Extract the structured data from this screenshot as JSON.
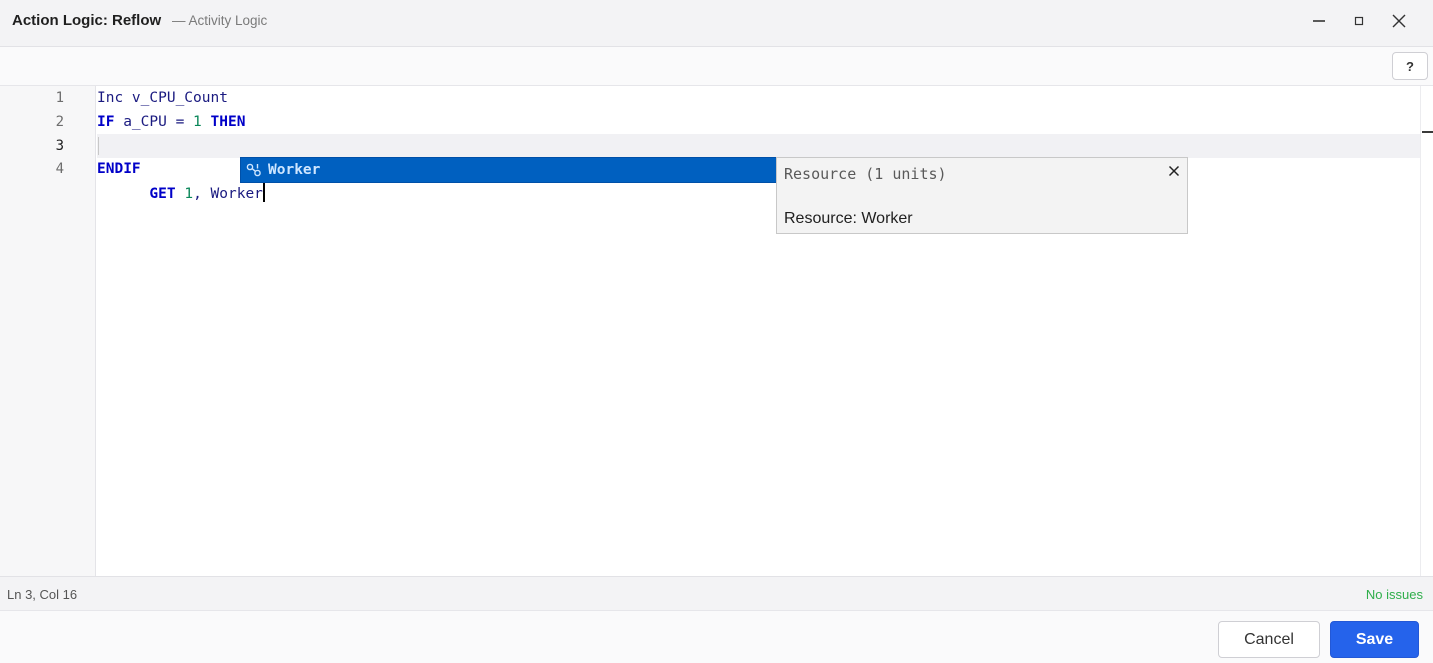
{
  "window": {
    "title": "Action Logic: Reflow",
    "subtitle": "— Activity Logic",
    "minimize_icon": "minimize-icon",
    "maximize_icon": "maximize-icon",
    "close_icon": "close-icon"
  },
  "toolbar": {
    "help_label": "?"
  },
  "editor": {
    "line_numbers": [
      "1",
      "2",
      "3",
      "4"
    ],
    "active_line": 3,
    "lines": [
      {
        "tokens": [
          {
            "text": "Inc v_CPU_Count",
            "kind": "ident"
          }
        ]
      },
      {
        "tokens": [
          {
            "text": "IF",
            "kind": "kw"
          },
          {
            "text": " a_CPU = ",
            "kind": "ident"
          },
          {
            "text": "1",
            "kind": "num"
          },
          {
            "text": " ",
            "kind": "ident"
          },
          {
            "text": "THEN",
            "kind": "kw"
          }
        ]
      },
      {
        "tokens": [
          {
            "text": "  ",
            "kind": "ident"
          },
          {
            "text": "GET",
            "kind": "kw"
          },
          {
            "text": " ",
            "kind": "ident"
          },
          {
            "text": "1",
            "kind": "num"
          },
          {
            "text": ", Worker",
            "kind": "ident"
          }
        ]
      },
      {
        "tokens": [
          {
            "text": "ENDIF",
            "kind": "kw"
          }
        ]
      }
    ]
  },
  "autocomplete": {
    "item_icon": "resource-icon",
    "item_label": "Worker",
    "details_signature": "Resource (1 units)",
    "details_doc": "Resource: Worker",
    "details_close_icon": "close-icon"
  },
  "status": {
    "cursor_position": "Ln 3, Col 16",
    "issues": "No issues"
  },
  "footer": {
    "cancel_label": "Cancel",
    "save_label": "Save"
  },
  "colors": {
    "keyword": "#0000c8",
    "number": "#098658",
    "identifier": "#1a1a80",
    "suggest_bg": "#0060c0",
    "save_button": "#2563eb",
    "issues_ok": "#2fae4b"
  }
}
